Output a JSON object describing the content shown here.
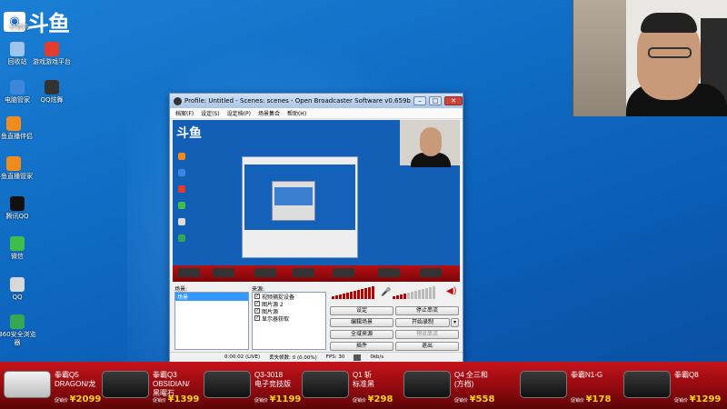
{
  "desktop": {
    "brand_text": "斗鱼",
    "icons": [
      {
        "label": "计算机",
        "color": "#6aa7e0"
      },
      {
        "label": "回收站",
        "color": "#9fc6ea"
      },
      {
        "label": "游戏游戏平台",
        "color": "#e23b2f"
      },
      {
        "label": "电脑管家",
        "color": "#3c86db"
      },
      {
        "label": "QQ炫舞",
        "color": "#333333"
      },
      {
        "label": "斗鱼直播伴侣",
        "color": "#f08c1e"
      },
      {
        "label": "斗鱼直播管家",
        "color": "#f08c1e"
      },
      {
        "label": "腾讯QQ",
        "color": "#111111"
      },
      {
        "label": "微信",
        "color": "#3fbf4a"
      },
      {
        "label": "QQ",
        "color": "#d8d8d8"
      },
      {
        "label": "360安全浏览器",
        "color": "#34a853"
      }
    ]
  },
  "obs": {
    "title": "Profile: Untitled - Scenes: scenes - Open Broadcaster Software v0.659b",
    "menu": [
      "档案(F)",
      "设定(S)",
      "设定档(P)",
      "场景集合",
      "帮助(H)"
    ],
    "scenes_label": "场景:",
    "scenes": [
      "场景"
    ],
    "sources_label": "来源:",
    "sources": [
      "视频捕捉设备",
      "图片源 2",
      "图片源",
      "显示器获取"
    ],
    "buttons": {
      "settings": "设定",
      "stop_stream": "停止串流",
      "edit_scene": "编辑场景",
      "start_record": "开始录制",
      "global_sources": "全域来源",
      "preview_stream": "预览串流",
      "plugins": "插件",
      "exit": "退出"
    },
    "status": {
      "time": "0:00:02 (LIVE)",
      "dropped": "丢失帧数: 0 (0.00%)",
      "fps": "FPS: 30",
      "bitrate": "0kb/s"
    },
    "preview_brand": "斗鱼"
  },
  "banner": {
    "products": [
      {
        "name": "拳霸Q5\nDRAGON/龙",
        "prefix": "促销价",
        "price": "¥2099",
        "stick": "white"
      },
      {
        "name": "拳霸Q3\nOBSIDIAN/\n黑曜石",
        "prefix": "促销价",
        "price": "¥1399",
        "stick": "black"
      },
      {
        "name": "Q3-3018\n电子竞技版",
        "prefix": "促销价",
        "price": "¥1199",
        "stick": "black"
      },
      {
        "name": "Q1 斩\n标准黑",
        "prefix": "促销价",
        "price": "¥298",
        "stick": "black"
      },
      {
        "name": "Q4 全三和\n(方档)",
        "prefix": "促销价",
        "price": "¥558",
        "stick": "black"
      },
      {
        "name": "拳霸N1-G",
        "prefix": "促销价",
        "price": "¥178",
        "stick": "black"
      },
      {
        "name": "拳霸Q8",
        "prefix": "促销价",
        "price": "¥1299",
        "stick": "black"
      }
    ]
  }
}
